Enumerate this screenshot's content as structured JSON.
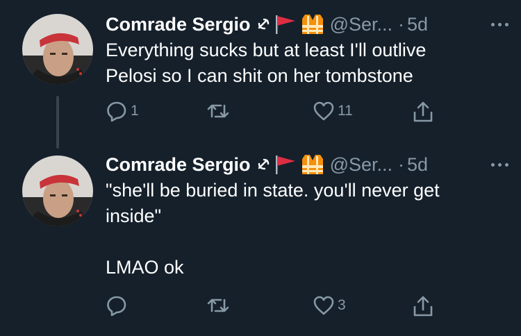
{
  "tweets": [
    {
      "author_name": "Comrade Sergio",
      "handle": "@Ser...",
      "separator": "·",
      "time": "5d",
      "text": "Everything sucks but at least I'll outlive\nPelosi so I can shit on her tombstone",
      "reply_count": "1",
      "retweet_count": "",
      "like_count": "11"
    },
    {
      "author_name": "Comrade Sergio",
      "handle": "@Ser...",
      "separator": "·",
      "time": "5d",
      "text": "\"she'll be buried in state. you'll never get\ninside\"\n\nLMAO ok",
      "reply_count": "",
      "retweet_count": "",
      "like_count": "3"
    }
  ],
  "icons": {
    "name_badges": [
      "hammer-sickle-icon",
      "red-flag-icon",
      "safety-vest-icon"
    ],
    "actions": [
      "reply-icon",
      "retweet-icon",
      "like-icon",
      "share-icon"
    ],
    "more": "more-options-icon"
  },
  "colors": {
    "background": "#15202b",
    "text_primary": "#ffffff",
    "text_secondary": "#8899a6",
    "thread_line": "#38444d"
  }
}
